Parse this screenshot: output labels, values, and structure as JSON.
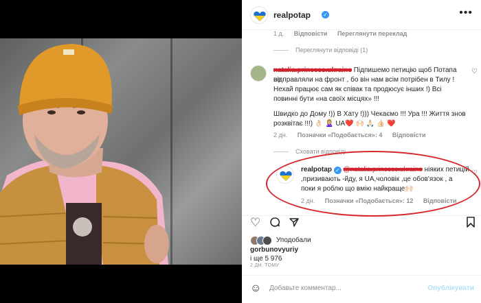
{
  "post": {
    "username": "realpotap",
    "verified_mark": "✓"
  },
  "top_meta": {
    "time": "1 д.",
    "reply": "Відповісти",
    "translate": "Переглянути переклад"
  },
  "view_replies": "Переглянути відповіді (1)",
  "comment1": {
    "username": "natalia.princess.ukraine",
    "text_line1": "Підпишемо петицію щоб Потапа не",
    "text_line2": "відправляли на фронт , бо він нам всім потрібен в Тилу !",
    "text_line3": "Нехай працює сам як співак та продюсує інших !) Всі",
    "text_line4": "повинні бути «на своїх місцях» !!!",
    "text_line5": "Швидко до Дому !)) В Хату !))) Чекаємо !!! Ура !!! Життя знов",
    "text_line6": "розквітає !!!) 👌🏻 🙎🏼‍♀️ UA❤️ 🙌🏻 🙏🏻 👍🏻 ❤️",
    "time": "2 дн.",
    "likes": "Позначки «Подобається»: 4",
    "reply": "Відповісти"
  },
  "hide_replies": "Сховати відповіді",
  "reply1": {
    "username": "realpotap",
    "mention": "@natalia.princess.ukraine",
    "text_line1_tail": " ніяких петицій",
    "text_line2": ",призивають -йду, я UA,чоловік ,це обов'язок , а",
    "text_line3": "поки я роблю що вмію найкраще🙌🏻",
    "time": "2 дн.",
    "likes": "Позначки «Подобається»: 12",
    "reply": "Відповісти"
  },
  "actions": {
    "like_icon": "heart-icon",
    "comment_icon": "comment-icon",
    "share_icon": "share-icon",
    "save_icon": "bookmark-icon"
  },
  "likes": {
    "liked_by_label": "Уподобали",
    "liked_user": "gorbunovyuriy",
    "others": "і ще 5 976"
  },
  "post_time": "2 ДН. ТОМУ",
  "add_comment": {
    "placeholder": "Добавьте комментар...",
    "publish": "Опублікувати"
  },
  "colors": {
    "highlight_circle": "#d6262c",
    "verified_blue": "#3897f0",
    "publish_disabled": "#b2dffc"
  }
}
